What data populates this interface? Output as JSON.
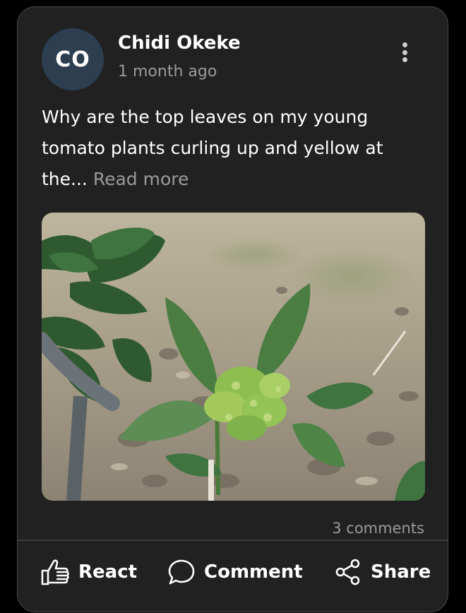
{
  "post": {
    "author": {
      "initials": "CO",
      "name": "Chidi Okeke",
      "avatar_color": "#2c3e50"
    },
    "time_ago": "1 month ago",
    "text": "Why are the top leaves on my young tomato plants curling up and yellow at the...",
    "read_more_label": "Read more",
    "image_description_icon": "plant-photo",
    "comments_count_label": "3 comments"
  },
  "actions": {
    "react_label": "React",
    "comment_label": "Comment",
    "share_label": "Share"
  },
  "colors": {
    "card_bg": "#212121",
    "page_bg": "#000000",
    "muted_text": "#9a9a9a",
    "primary_text": "#ffffff"
  }
}
